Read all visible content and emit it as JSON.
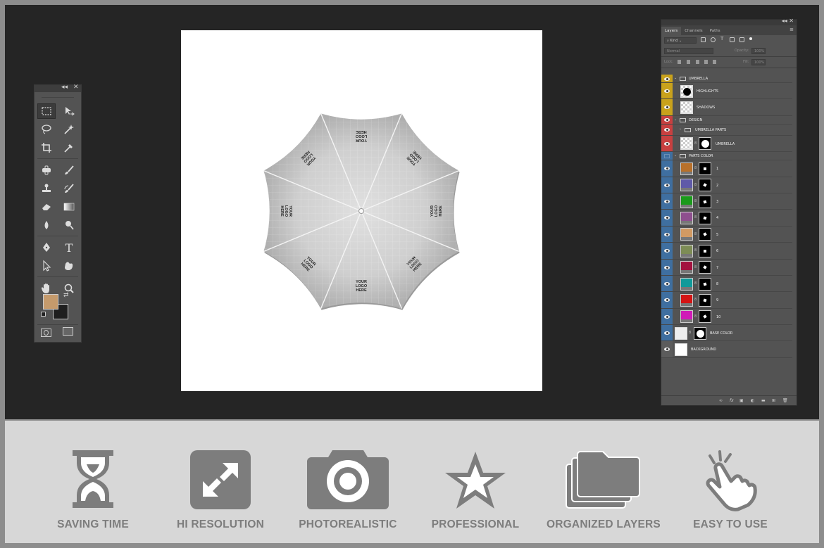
{
  "tools_panel": {
    "collapse_label": "◂◂",
    "close_label": "✕",
    "tools": [
      "marquee-icon",
      "move-icon",
      "lasso-icon",
      "magic-wand-icon",
      "crop-icon",
      "eyedropper-icon",
      "healing-brush-icon",
      "brush-icon",
      "clone-stamp-icon",
      "history-brush-icon",
      "eraser-icon",
      "gradient-icon",
      "blur-icon",
      "dodge-icon",
      "pen-icon",
      "type-icon",
      "path-selection-icon",
      "custom-shape-icon",
      "hand-icon",
      "zoom-icon"
    ],
    "type_tool_glyph": "T",
    "foreground_color": "#c49a6c",
    "background_color": "#1e1e1e"
  },
  "canvas": {
    "logo_text_line1": "YOUR",
    "logo_text_line2": "LOGO",
    "logo_text_line3": "HERE"
  },
  "layers_panel": {
    "tabs": [
      "Layers",
      "Channels",
      "Paths"
    ],
    "filter_label": "Kind",
    "blend_mode": "Normal",
    "opacity_label": "Opacity:",
    "opacity_value": "100%",
    "lock_label": "Lock:",
    "fill_label": "Fill:",
    "fill_value": "100%",
    "groups": {
      "umbrella": "UMBRELLA",
      "design": "DESIGN",
      "umbrella_parts": "UMBRELLA PARTS",
      "parts_color": "PARTS COLOR"
    },
    "layers": {
      "highlights": "HIGHLIGHTS",
      "shadows": "SHADOWS",
      "umbrella": "UMBRELLA",
      "base_color": "BASE COLOR",
      "background": "BACKGROUND"
    },
    "color_parts": [
      {
        "name": "1",
        "color": "#b8702a"
      },
      {
        "name": "2",
        "color": "#5f5aa8"
      },
      {
        "name": "3",
        "color": "#1a9a1a"
      },
      {
        "name": "4",
        "color": "#8e4f8e"
      },
      {
        "name": "5",
        "color": "#d29a63"
      },
      {
        "name": "6",
        "color": "#7d8c55"
      },
      {
        "name": "7",
        "color": "#a3123f"
      },
      {
        "name": "8",
        "color": "#109a9a"
      },
      {
        "name": "9",
        "color": "#d41414"
      },
      {
        "name": "10",
        "color": "#d01ab7"
      }
    ],
    "tag_colors": {
      "umbrella": "#c9a21c",
      "design": "#c84040",
      "parts": "#3f6fa0",
      "base": "#3f6fa0"
    }
  },
  "features": [
    {
      "label": "SAVING TIME",
      "icon": "hourglass-icon"
    },
    {
      "label": "HI RESOLUTION",
      "icon": "expand-arrows-icon"
    },
    {
      "label": "PHOTOREALISTIC",
      "icon": "camera-icon"
    },
    {
      "label": "PROFESSIONAL",
      "icon": "star-icon"
    },
    {
      "label": "ORGANIZED LAYERS",
      "icon": "layers-folder-icon"
    },
    {
      "label": "EASY TO USE",
      "icon": "tap-hand-icon"
    }
  ]
}
